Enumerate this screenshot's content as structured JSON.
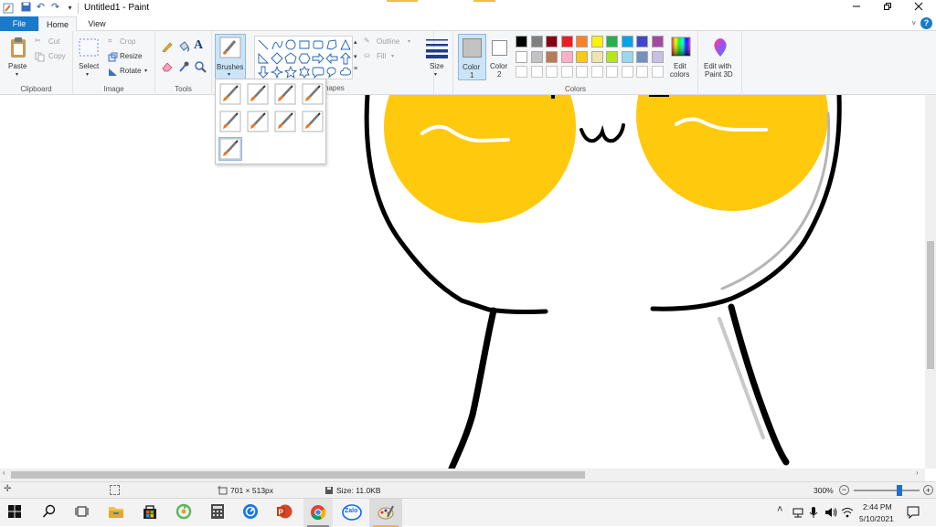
{
  "window": {
    "title": "Untitled1 - Paint"
  },
  "tabs": {
    "file": "File",
    "home": "Home",
    "view": "View"
  },
  "clipboard": {
    "paste": "Paste",
    "cut": "Cut",
    "copy": "Copy",
    "group": "Clipboard"
  },
  "image": {
    "select": "Select",
    "crop": "Crop",
    "resize": "Resize",
    "rotate": "Rotate",
    "group": "Image"
  },
  "tools": {
    "group": "Tools"
  },
  "brushes": {
    "label": "Brushes"
  },
  "shapes": {
    "outline": "Outline",
    "fill": "Fill",
    "group_partial": "hapes"
  },
  "size": {
    "label": "Size"
  },
  "colors": {
    "color1": "Color",
    "color1_num": "1",
    "color2": "Color",
    "color2_num": "2",
    "edit": "Edit",
    "edit2": "colors",
    "group": "Colors",
    "color1_value": "#c3c3c3",
    "color2_value": "#ffffff",
    "palette": [
      "#000000",
      "#7f7f7f",
      "#880015",
      "#ed1c24",
      "#ff7f27",
      "#fff200",
      "#22b14c",
      "#00a2e8",
      "#3f48cc",
      "#a349a4",
      "#ffffff",
      "#c3c3c3",
      "#b97a57",
      "#ffaec9",
      "#ffc90e",
      "#efe4b0",
      "#b5e61d",
      "#99d9ea",
      "#7092be",
      "#c8bfe7"
    ]
  },
  "paint3d": {
    "line1": "Edit with",
    "line2": "Paint 3D"
  },
  "status": {
    "dimensions": "701 × 513px",
    "size": "Size: 11.0KB",
    "zoom": "300%",
    "zoom_level": 0.7
  },
  "taskbar": {
    "time": "2:44 PM",
    "date": "5/10/2021",
    "zalo": "Zalo"
  }
}
